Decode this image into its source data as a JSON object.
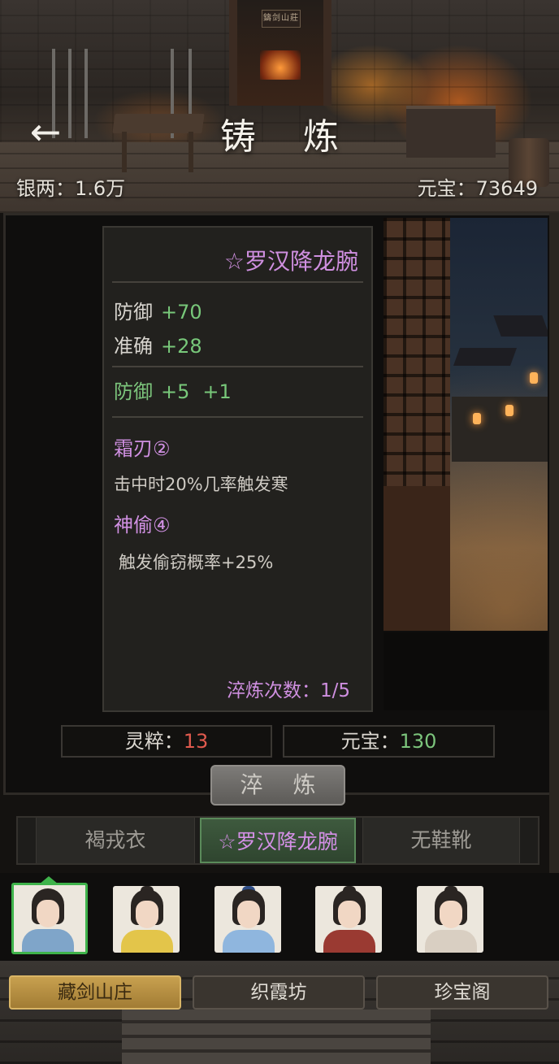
{
  "header": {
    "title": "铸 炼",
    "back_icon": "arrow-left-icon",
    "silver_label": "银两：",
    "silver_value": "1.6万",
    "ingot_label": "元宝：",
    "ingot_value": "73649",
    "gate_plaque": "鑄剑山莊"
  },
  "item": {
    "name": "☆罗汉降龙腕",
    "base_stats": [
      {
        "label": "防御",
        "value": "+70"
      },
      {
        "label": "准确",
        "value": "+28"
      }
    ],
    "bonus_stat": {
      "label": "防御",
      "value": "+5",
      "extra": "+1"
    },
    "skills": [
      {
        "name": "霜刃②",
        "desc": "击中时20%几率触发寒"
      },
      {
        "name": "神偷④",
        "desc": "触发偷窃概率+25%"
      }
    ],
    "refine_count_label": "淬炼次数：",
    "refine_count_value": "1/5"
  },
  "costs": {
    "essence_label": "灵粹：",
    "essence_value": "13",
    "ingot_label": "元宝：",
    "ingot_value": "130"
  },
  "refine_button": "淬 炼",
  "equipment_tabs": [
    {
      "label": "褐戎衣",
      "active": false
    },
    {
      "label": "☆罗汉降龙腕",
      "active": true
    },
    {
      "label": "无鞋靴",
      "active": false
    }
  ],
  "characters": [
    {
      "name": "character-portrait-1",
      "robe_color": "#7fa5c9",
      "selected": true
    },
    {
      "name": "character-portrait-2",
      "robe_color": "#e3c54a",
      "selected": false
    },
    {
      "name": "character-portrait-3",
      "robe_color": "#8fb6de",
      "selected": false
    },
    {
      "name": "character-portrait-4",
      "robe_color": "#9a3a32",
      "selected": false
    },
    {
      "name": "character-portrait-5",
      "robe_color": "#d9cfc2",
      "selected": false
    }
  ],
  "bottom_nav": [
    {
      "label": "藏剑山庄",
      "active": true
    },
    {
      "label": "织霞坊",
      "active": false
    },
    {
      "label": "珍宝阁",
      "active": false
    }
  ],
  "colors": {
    "item_name": "#cf8fe0",
    "stat_value": "#78c87a",
    "cost_red": "#e05a4e",
    "cost_green": "#7cc57c",
    "nav_active": "#c8a04f",
    "select_green": "#3fb34b"
  }
}
